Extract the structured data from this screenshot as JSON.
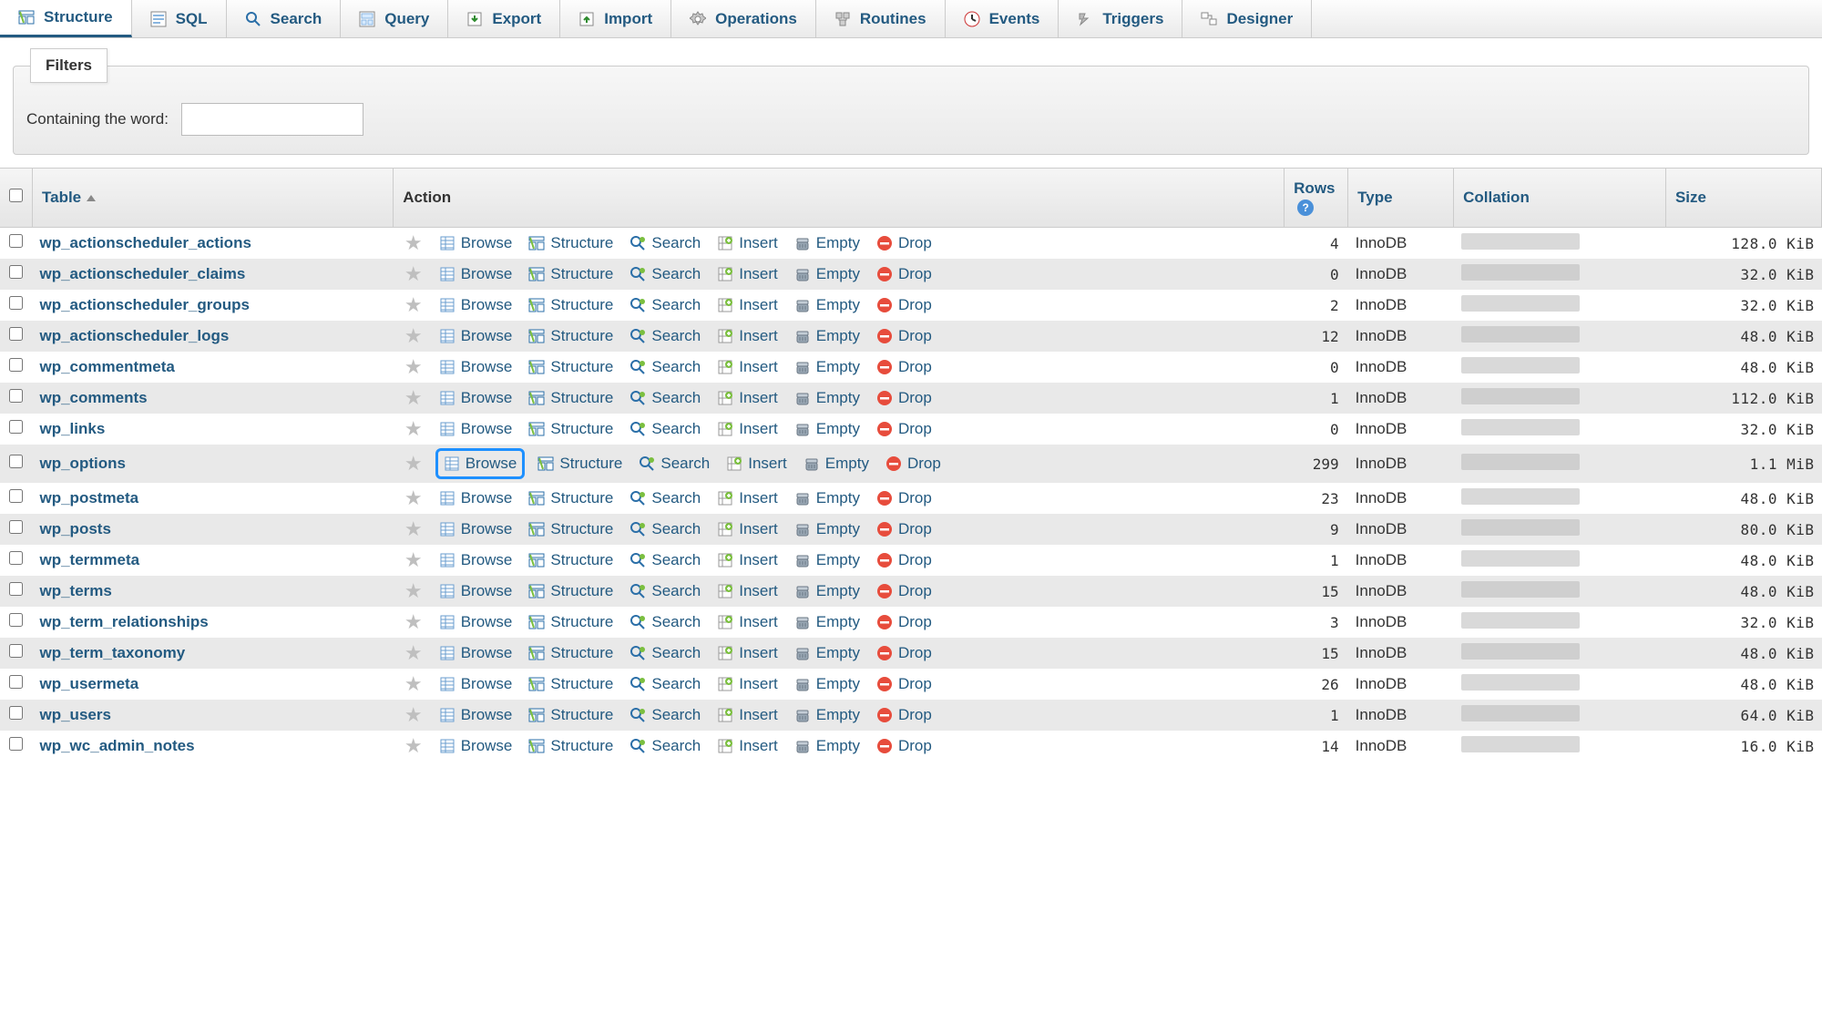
{
  "tabs": [
    {
      "key": "structure",
      "label": "Structure",
      "icon": "structure"
    },
    {
      "key": "sql",
      "label": "SQL",
      "icon": "sql"
    },
    {
      "key": "search",
      "label": "Search",
      "icon": "search"
    },
    {
      "key": "query",
      "label": "Query",
      "icon": "query"
    },
    {
      "key": "export",
      "label": "Export",
      "icon": "export"
    },
    {
      "key": "import",
      "label": "Import",
      "icon": "import"
    },
    {
      "key": "operations",
      "label": "Operations",
      "icon": "operations"
    },
    {
      "key": "routines",
      "label": "Routines",
      "icon": "routines"
    },
    {
      "key": "events",
      "label": "Events",
      "icon": "events"
    },
    {
      "key": "triggers",
      "label": "Triggers",
      "icon": "triggers"
    },
    {
      "key": "designer",
      "label": "Designer",
      "icon": "designer"
    }
  ],
  "active_tab": "structure",
  "filters": {
    "legend": "Filters",
    "label": "Containing the word:",
    "value": ""
  },
  "columns": {
    "table": "Table",
    "action": "Action",
    "rows": "Rows",
    "type": "Type",
    "collation": "Collation",
    "size": "Size"
  },
  "action_labels": {
    "browse": "Browse",
    "structure": "Structure",
    "search": "Search",
    "insert": "Insert",
    "empty": "Empty",
    "drop": "Drop"
  },
  "tables": [
    {
      "name": "wp_actionscheduler_actions",
      "rows": 4,
      "type": "InnoDB",
      "size": "128.0 KiB"
    },
    {
      "name": "wp_actionscheduler_claims",
      "rows": 0,
      "type": "InnoDB",
      "size": "32.0 KiB"
    },
    {
      "name": "wp_actionscheduler_groups",
      "rows": 2,
      "type": "InnoDB",
      "size": "32.0 KiB"
    },
    {
      "name": "wp_actionscheduler_logs",
      "rows": 12,
      "type": "InnoDB",
      "size": "48.0 KiB"
    },
    {
      "name": "wp_commentmeta",
      "rows": 0,
      "type": "InnoDB",
      "size": "48.0 KiB"
    },
    {
      "name": "wp_comments",
      "rows": 1,
      "type": "InnoDB",
      "size": "112.0 KiB"
    },
    {
      "name": "wp_links",
      "rows": 0,
      "type": "InnoDB",
      "size": "32.0 KiB"
    },
    {
      "name": "wp_options",
      "rows": 299,
      "type": "InnoDB",
      "size": "1.1 MiB",
      "highlight_browse": true
    },
    {
      "name": "wp_postmeta",
      "rows": 23,
      "type": "InnoDB",
      "size": "48.0 KiB"
    },
    {
      "name": "wp_posts",
      "rows": 9,
      "type": "InnoDB",
      "size": "80.0 KiB"
    },
    {
      "name": "wp_termmeta",
      "rows": 1,
      "type": "InnoDB",
      "size": "48.0 KiB"
    },
    {
      "name": "wp_terms",
      "rows": 15,
      "type": "InnoDB",
      "size": "48.0 KiB"
    },
    {
      "name": "wp_term_relationships",
      "rows": 3,
      "type": "InnoDB",
      "size": "32.0 KiB"
    },
    {
      "name": "wp_term_taxonomy",
      "rows": 15,
      "type": "InnoDB",
      "size": "48.0 KiB"
    },
    {
      "name": "wp_usermeta",
      "rows": 26,
      "type": "InnoDB",
      "size": "48.0 KiB"
    },
    {
      "name": "wp_users",
      "rows": 1,
      "type": "InnoDB",
      "size": "64.0 KiB"
    },
    {
      "name": "wp_wc_admin_notes",
      "rows": 14,
      "type": "InnoDB",
      "size": "16.0 KiB"
    }
  ]
}
